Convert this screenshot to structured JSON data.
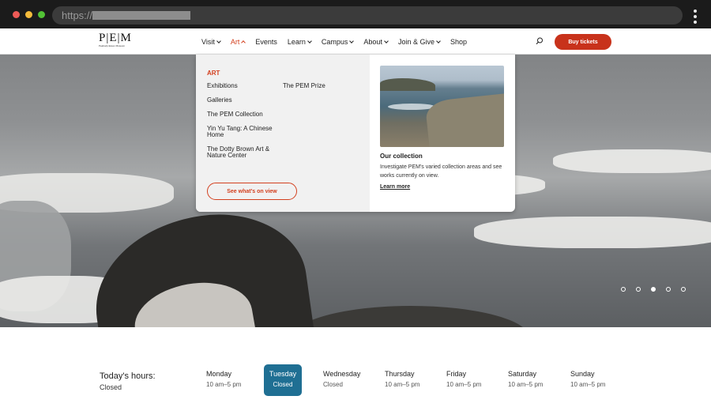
{
  "browser": {
    "url_scheme": "https://"
  },
  "header": {
    "logo_text": "P|E|M",
    "logo_sub": "Peabody Essex Museum",
    "nav": [
      {
        "label": "Visit",
        "dropdown": true
      },
      {
        "label": "Art",
        "dropdown": true,
        "active": true
      },
      {
        "label": "Events",
        "dropdown": false
      },
      {
        "label": "Learn",
        "dropdown": true
      },
      {
        "label": "Campus",
        "dropdown": true
      },
      {
        "label": "About",
        "dropdown": true
      },
      {
        "label": "Join & Give",
        "dropdown": true
      },
      {
        "label": "Shop",
        "dropdown": false
      }
    ],
    "buy_label": "Buy tickets",
    "accent_color": "#c8321b"
  },
  "dropdown": {
    "heading": "ART",
    "col1": [
      "Exhibitions",
      "Galleries",
      "The PEM Collection",
      "Yin Yu Tang: A Chinese Home",
      "The Dotty Brown Art & Nature Center"
    ],
    "col2": [
      "The PEM Prize"
    ],
    "view_button": "See what's on view",
    "card": {
      "title": "Our collection",
      "description": "Investigate PEM's varied collection areas and see works currently on view.",
      "link": "Learn more"
    }
  },
  "hero": {
    "slide_count": 5,
    "active_slide": 3
  },
  "hours": {
    "title": "Today's hours:",
    "status": "Closed",
    "today_color": "#1f6f93",
    "days": [
      {
        "name": "Monday",
        "time": "10 am–5 pm"
      },
      {
        "name": "Tuesday",
        "time": "Closed",
        "today": true
      },
      {
        "name": "Wednesday",
        "time": "Closed"
      },
      {
        "name": "Thursday",
        "time": "10 am–5 pm"
      },
      {
        "name": "Friday",
        "time": "10 am–5 pm"
      },
      {
        "name": "Saturday",
        "time": "10 am–5 pm"
      },
      {
        "name": "Sunday",
        "time": "10 am–5 pm"
      }
    ]
  }
}
